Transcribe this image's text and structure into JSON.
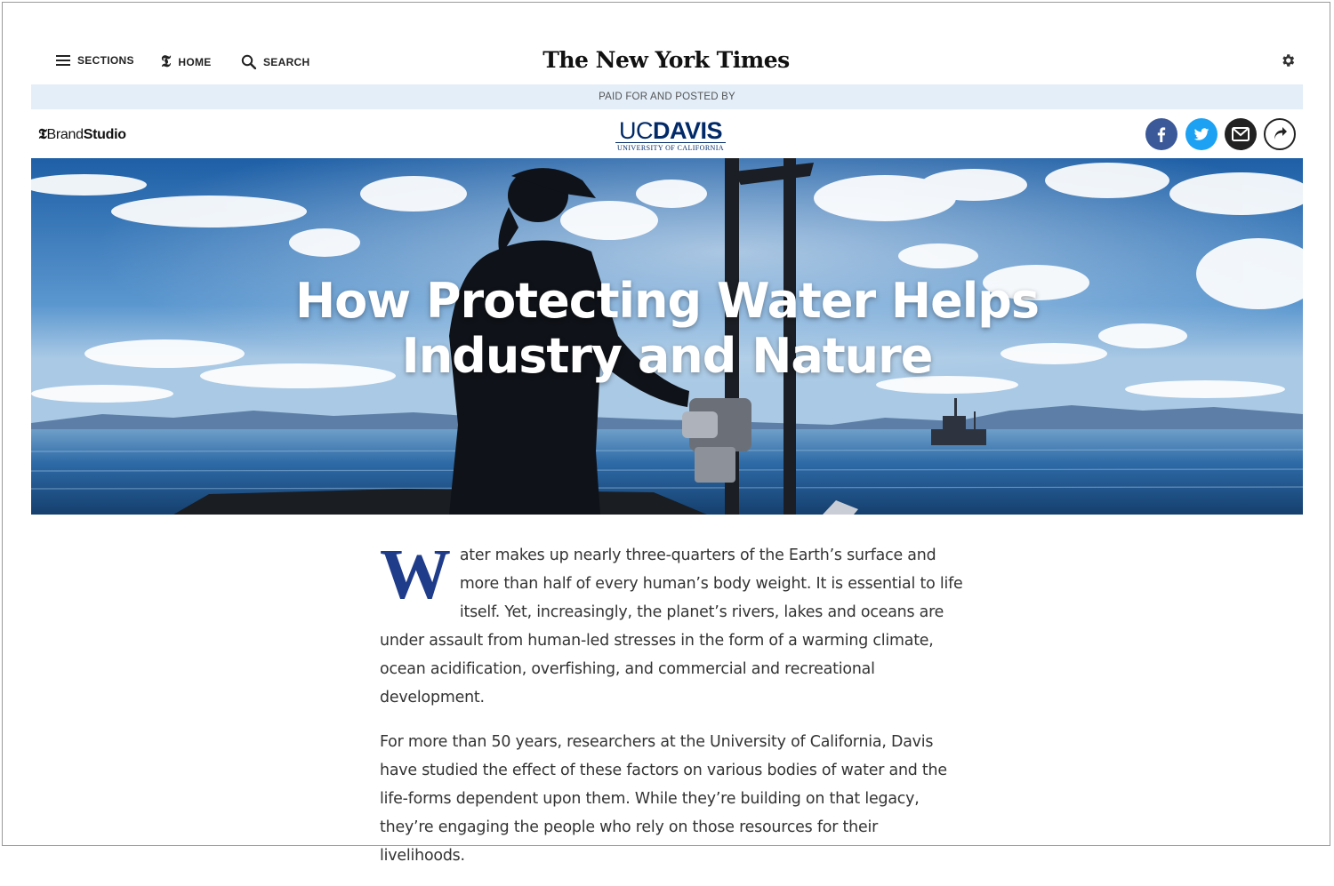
{
  "nav": {
    "sections_label": "SECTIONS",
    "home_label": "HOME",
    "search_label": "SEARCH",
    "home_logo_glyph": "𝕿",
    "masthead": "The New York Times"
  },
  "sponsor": {
    "paid_label": "PAID FOR AND POSTED BY",
    "brandstudio_t": "𝕿",
    "brandstudio_brand": "Brand",
    "brandstudio_studio": "Studio",
    "uc_logo_uc": "UC",
    "uc_logo_davis": "DAVIS",
    "uc_logo_sub": "UNIVERSITY OF CALIFORNIA"
  },
  "share": {
    "facebook": "facebook-icon",
    "twitter": "twitter-icon",
    "email": "email-icon",
    "share": "share-arrow-icon"
  },
  "hero": {
    "title_line1": "How Protecting Water Helps",
    "title_line2": "Industry and Nature"
  },
  "article": {
    "dropcap": "W",
    "p1_rest": "ater makes up nearly three-quarters of the Earth’s surface and more than half of every human’s body weight. It is essential to life itself. Yet, increasingly, the planet’s rivers, lakes and oceans are under assault from human-led stresses in the form of a warming climate, ocean acidification, overfishing, and commercial and recreational development.",
    "p2": "For more than 50 years, researchers at the University of California, Davis have studied the effect of these factors on various bodies of water and the life-forms dependent upon them. While they’re building on that legacy, they’re engaging the people who rely on those resources for their livelihoods."
  },
  "colors": {
    "paid_bar": "#e3eef9",
    "dropcap": "#1f3c8a",
    "ucdavis": "#022a68",
    "facebook": "#3b5998",
    "twitter": "#1da1f2"
  }
}
